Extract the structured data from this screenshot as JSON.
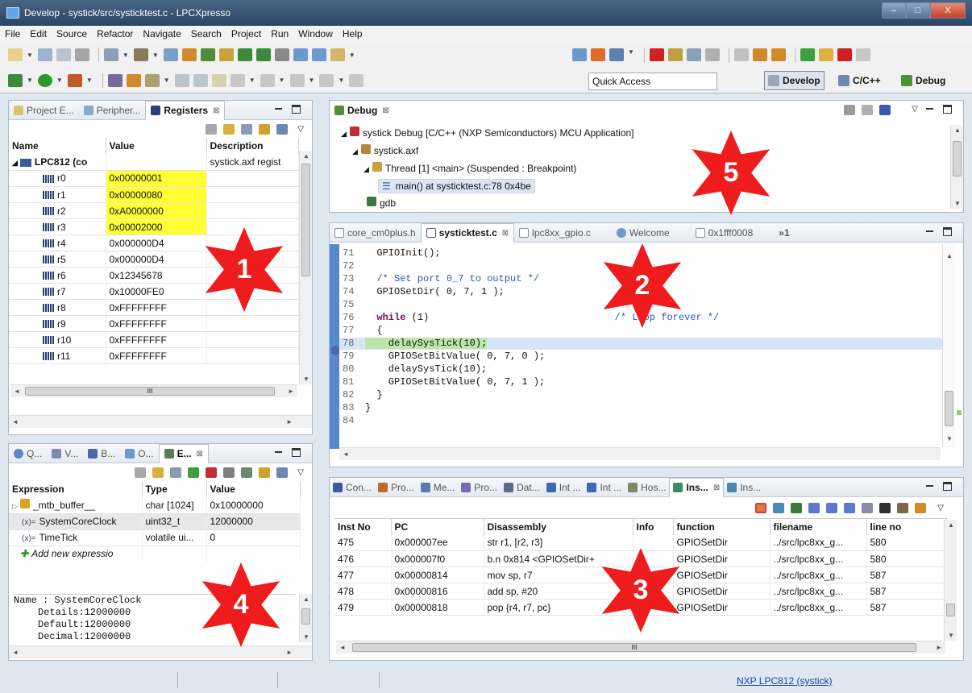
{
  "window": {
    "title": "Develop - systick/src/systicktest.c - LPCXpresso"
  },
  "menu": [
    "File",
    "Edit",
    "Source",
    "Refactor",
    "Navigate",
    "Search",
    "Project",
    "Run",
    "Window",
    "Help"
  ],
  "toolbar": {
    "quick_access": "Quick Access"
  },
  "perspectives": {
    "develop": "Develop",
    "cpp": "C/C++",
    "debug": "Debug"
  },
  "registers_panel": {
    "tabs": {
      "project": "Project E...",
      "peripherals": "Peripher...",
      "registers": "Registers"
    },
    "columns": {
      "name": "Name",
      "value": "Value",
      "description": "Description"
    },
    "root": {
      "name": "LPC812 (co",
      "description": "systick.axf regist"
    },
    "rows": [
      {
        "name": "r0",
        "value": "0x00000001",
        "highlight": true
      },
      {
        "name": "r1",
        "value": "0x00000080",
        "highlight": true
      },
      {
        "name": "r2",
        "value": "0xA0000000",
        "highlight": true
      },
      {
        "name": "r3",
        "value": "0x00002000",
        "highlight": true
      },
      {
        "name": "r4",
        "value": "0x000000D4",
        "highlight": false
      },
      {
        "name": "r5",
        "value": "0x000000D4",
        "highlight": false
      },
      {
        "name": "r6",
        "value": "0x12345678",
        "highlight": false
      },
      {
        "name": "r7",
        "value": "0x10000FE0",
        "highlight": false
      },
      {
        "name": "r8",
        "value": "0xFFFFFFFF",
        "highlight": false
      },
      {
        "name": "r9",
        "value": "0xFFFFFFFF",
        "highlight": false
      },
      {
        "name": "r10",
        "value": "0xFFFFFFFF",
        "highlight": false
      },
      {
        "name": "r11",
        "value": "0xFFFFFFFF",
        "highlight": false
      }
    ]
  },
  "expressions_panel": {
    "tabs": {
      "t1": "Q...",
      "t2": "V...",
      "t3": "B...",
      "t4": "O...",
      "active": "E..."
    },
    "columns": {
      "expression": "Expression",
      "type": "Type",
      "value": "Value"
    },
    "rows": [
      {
        "expr": "_mtb_buffer__",
        "type": "char [1024]",
        "value": "0x10000000"
      },
      {
        "expr": "SystemCoreClock",
        "type": "uint32_t",
        "value": "12000000"
      },
      {
        "expr": "TimeTick",
        "type": "volatile ui...",
        "value": "0"
      }
    ],
    "add_new": "Add new expressio",
    "detail": {
      "line1": "Name : SystemCoreClock",
      "line2": "Details:12000000",
      "line3": "Default:12000000",
      "line4": "Decimal:12000000"
    }
  },
  "debug_panel": {
    "tab": "Debug",
    "tree": {
      "launch": "systick Debug [C/C++ (NXP Semiconductors) MCU Application]",
      "axf": "systick.axf",
      "thread": "Thread [1] <main> (Suspended : Breakpoint)",
      "frame": "main() at systicktest.c:78 0x4be",
      "gdb": "gdb"
    }
  },
  "editor": {
    "tabs": [
      "core_cm0plus.h",
      "systicktest.c",
      "lpc8xx_gpio.c",
      "Welcome",
      "0x1fff0008"
    ],
    "overflow": "»1",
    "lines": [
      {
        "n": "71",
        "code": "  GPIOInit();"
      },
      {
        "n": "72",
        "code": ""
      },
      {
        "n": "73",
        "code": "  /* Set port 0_7 to output */"
      },
      {
        "n": "74",
        "code": "  GPIOSetDir( 0, 7, 1 );"
      },
      {
        "n": "75",
        "code": ""
      },
      {
        "n": "76",
        "code": "  while (1)                                /* Loop forever */"
      },
      {
        "n": "77",
        "code": "  {"
      },
      {
        "n": "78",
        "code": "    delaySysTick(10);"
      },
      {
        "n": "79",
        "code": "    GPIOSetBitValue( 0, 7, 0 );"
      },
      {
        "n": "80",
        "code": "    delaySysTick(10);"
      },
      {
        "n": "81",
        "code": "    GPIOSetBitValue( 0, 7, 1 );"
      },
      {
        "n": "82",
        "code": "  }"
      },
      {
        "n": "83",
        "code": "}"
      },
      {
        "n": "84",
        "code": ""
      }
    ]
  },
  "trace_panel": {
    "tabs": [
      "Con...",
      "Pro...",
      "Me...",
      "Pro...",
      "Dat...",
      "Int ...",
      "Int ...",
      "Hos...",
      "Ins...",
      "Ins..."
    ],
    "columns": [
      "Inst No",
      "PC",
      "Disassembly",
      "Info",
      "function",
      "filename",
      "line no"
    ],
    "rows": [
      {
        "inst": "475",
        "pc": "0x000007ee",
        "dis": "str r1, [r2, r3]",
        "info": "",
        "func": "GPIOSetDir",
        "file": "../src/lpc8xx_g...",
        "line": "580"
      },
      {
        "inst": "476",
        "pc": "0x000007f0",
        "dis": "b.n 0x814 <GPIOSetDir+",
        "info": "",
        "func": "GPIOSetDir",
        "file": "../src/lpc8xx_g...",
        "line": "580"
      },
      {
        "inst": "477",
        "pc": "0x00000814",
        "dis": "mov sp, r7",
        "info": "",
        "func": "GPIOSetDir",
        "file": "../src/lpc8xx_g...",
        "line": "587"
      },
      {
        "inst": "478",
        "pc": "0x00000816",
        "dis": "add sp, #20",
        "info": "",
        "func": "GPIOSetDir",
        "file": "../src/lpc8xx_g...",
        "line": "587"
      },
      {
        "inst": "479",
        "pc": "0x00000818",
        "dis": "pop {r4, r7, pc}",
        "info": "",
        "func": "GPIOSetDir",
        "file": "../src/lpc8xx_g...",
        "line": "587"
      }
    ]
  },
  "stars": [
    "1",
    "2",
    "3",
    "4",
    "5"
  ],
  "statusbar": {
    "link": "NXP LPC812 (systick)"
  },
  "colors": {
    "star_red": "#ee1c1c",
    "highlight_yellow": "#ffff33",
    "accent_blue": "#5588cc"
  }
}
